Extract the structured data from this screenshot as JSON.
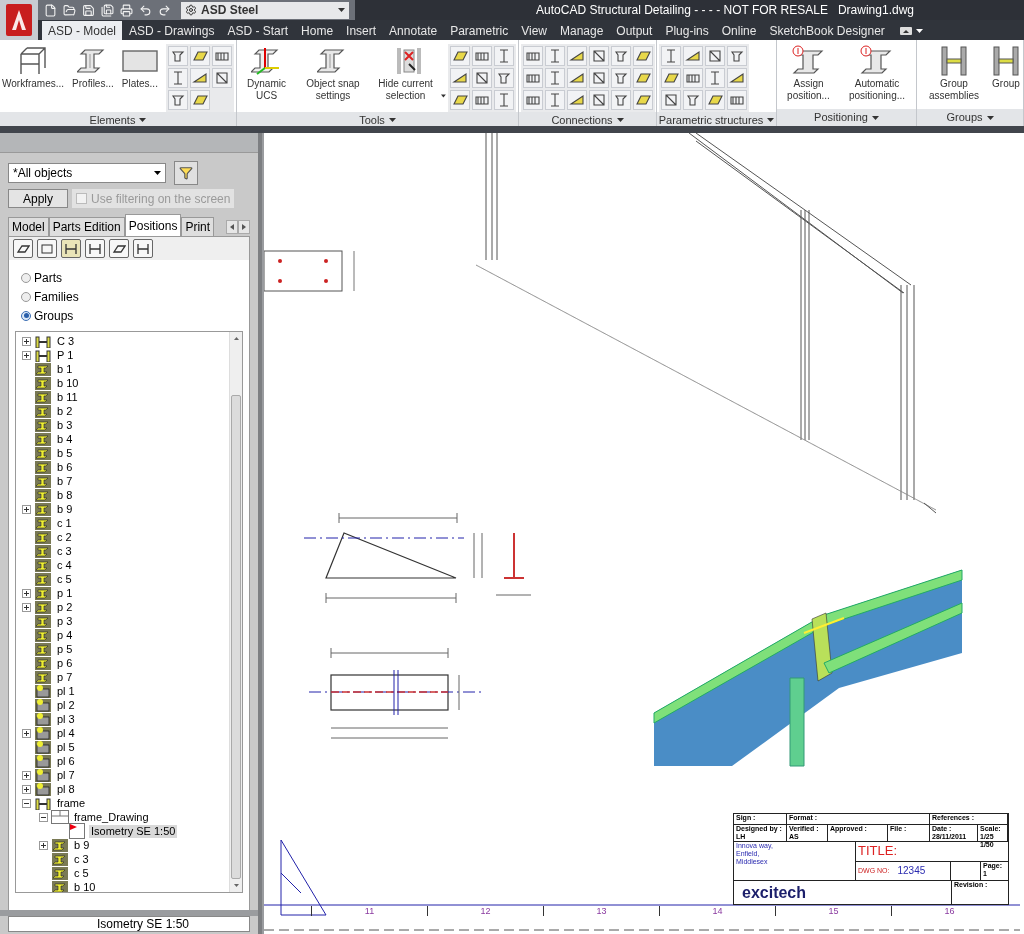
{
  "title_bar": {
    "workspace": "ASD Steel",
    "title": "AutoCAD Structural Detailing - - - - NOT FOR RESALE",
    "document": "Drawing1.dwg"
  },
  "ribbon_tabs": [
    {
      "label": "ASD - Model",
      "selected": true
    },
    {
      "label": "ASD - Drawings",
      "selected": false
    },
    {
      "label": "ASD - Start",
      "selected": false
    },
    {
      "label": "Home",
      "selected": false
    },
    {
      "label": "Insert",
      "selected": false
    },
    {
      "label": "Annotate",
      "selected": false
    },
    {
      "label": "Parametric",
      "selected": false
    },
    {
      "label": "View",
      "selected": false
    },
    {
      "label": "Manage",
      "selected": false
    },
    {
      "label": "Output",
      "selected": false
    },
    {
      "label": "Plug-ins",
      "selected": false
    },
    {
      "label": "Online",
      "selected": false
    },
    {
      "label": "SketchBook Designer",
      "selected": false
    }
  ],
  "ribbon_panels": [
    {
      "title": "Elements",
      "buttons": [
        {
          "label": "Workframes...",
          "kind": "frame",
          "menu": false
        },
        {
          "label": "Profiles...",
          "kind": "beam",
          "menu": false
        },
        {
          "label": "Plates...",
          "kind": "plate",
          "menu": false
        }
      ]
    },
    {
      "title": "Tools",
      "buttons": [
        {
          "label": "Dynamic UCS",
          "kind": "ucs",
          "menu": false
        },
        {
          "label": "Object snap settings",
          "kind": "beam",
          "menu": false
        },
        {
          "label": "Hide current selection",
          "kind": "hide",
          "menu": true
        }
      ]
    },
    {
      "title": "Connections"
    },
    {
      "title": "Parametric structures"
    },
    {
      "title": "Positioning",
      "buttons": [
        {
          "label": "Assign position...",
          "kind": "position",
          "menu": false
        },
        {
          "label": "Automatic positioning...",
          "kind": "position",
          "menu": false
        }
      ]
    },
    {
      "title": "Groups",
      "buttons": [
        {
          "label": "Group assemblies",
          "kind": "group",
          "menu": false
        },
        {
          "label": "Group",
          "kind": "group",
          "menu": false
        }
      ]
    }
  ],
  "filter": {
    "value": "*All objects"
  },
  "apply_button": "Apply",
  "screen_filter": {
    "label": "Use filtering on the screen",
    "checked": false,
    "disabled": true
  },
  "panel_tabs": [
    {
      "label": "Model",
      "selected": false
    },
    {
      "label": "Parts Edition",
      "selected": false
    },
    {
      "label": "Positions",
      "selected": true
    },
    {
      "label": "Print",
      "selected": false
    }
  ],
  "mode_options": [
    {
      "label": "Parts",
      "selected": false
    },
    {
      "label": "Families",
      "selected": false
    },
    {
      "label": "Groups",
      "selected": true
    }
  ],
  "tree": [
    {
      "label": "C 3",
      "kind": "assembly",
      "expanded": false,
      "selected": false
    },
    {
      "label": "P 1",
      "kind": "assembly",
      "expanded": false,
      "selected": false
    },
    {
      "label": "b 1",
      "kind": "beam",
      "selected": false
    },
    {
      "label": "b 10",
      "kind": "beam",
      "selected": false
    },
    {
      "label": "b 11",
      "kind": "beam",
      "selected": false
    },
    {
      "label": "b 2",
      "kind": "beam",
      "selected": false
    },
    {
      "label": "b 3",
      "kind": "beam",
      "selected": false
    },
    {
      "label": "b 4",
      "kind": "beam",
      "selected": false
    },
    {
      "label": "b 5",
      "kind": "beam",
      "selected": false
    },
    {
      "label": "b 6",
      "kind": "beam",
      "selected": false
    },
    {
      "label": "b 7",
      "kind": "beam",
      "selected": false
    },
    {
      "label": "b 8",
      "kind": "beam",
      "selected": false
    },
    {
      "label": "b 9",
      "kind": "beam",
      "expanded": false,
      "selected": false
    },
    {
      "label": "c 1",
      "kind": "beam",
      "selected": false
    },
    {
      "label": "c 2",
      "kind": "beam",
      "selected": false
    },
    {
      "label": "c 3",
      "kind": "beam",
      "selected": false
    },
    {
      "label": "c 4",
      "kind": "beam",
      "selected": false
    },
    {
      "label": "c 5",
      "kind": "beam",
      "selected": false
    },
    {
      "label": "p 1",
      "kind": "beam",
      "expanded": false,
      "selected": false
    },
    {
      "label": "p 2",
      "kind": "beam",
      "expanded": false,
      "selected": false
    },
    {
      "label": "p 3",
      "kind": "beam",
      "selected": false
    },
    {
      "label": "p 4",
      "kind": "beam",
      "selected": false
    },
    {
      "label": "p 5",
      "kind": "beam",
      "selected": false
    },
    {
      "label": "p 6",
      "kind": "beam",
      "selected": false
    },
    {
      "label": "p 7",
      "kind": "beam",
      "selected": false
    },
    {
      "label": "pl 1",
      "kind": "plate",
      "selected": false
    },
    {
      "label": "pl 2",
      "kind": "plate",
      "selected": false
    },
    {
      "label": "pl 3",
      "kind": "plate",
      "selected": false
    },
    {
      "label": "pl 4",
      "kind": "plate",
      "expanded": false,
      "selected": false
    },
    {
      "label": "pl 5",
      "kind": "plate",
      "selected": false
    },
    {
      "label": "pl 6",
      "kind": "plate",
      "selected": false
    },
    {
      "label": "pl 7",
      "kind": "plate",
      "expanded": false,
      "selected": false
    },
    {
      "label": "pl 8",
      "kind": "plate",
      "expanded": false,
      "selected": false
    },
    {
      "label": "frame",
      "kind": "assembly",
      "expanded": true,
      "selected": false,
      "children": [
        {
          "label": "frame_Drawing",
          "kind": "drawing",
          "expanded": true,
          "selected": false,
          "children": [
            {
              "label": "Isometry SE 1:50",
              "kind": "view",
              "selected": true
            }
          ]
        },
        {
          "label": "b 9",
          "kind": "beam",
          "expanded": false,
          "selected": false
        },
        {
          "label": "c 3",
          "kind": "beam",
          "selected": false
        },
        {
          "label": "c 5",
          "kind": "beam",
          "selected": false
        },
        {
          "label": "b 10",
          "kind": "beam",
          "selected": false
        }
      ]
    }
  ],
  "status": "Isometry SE 1:50",
  "title_block": {
    "top_row": [
      "Sign :",
      "Format :",
      "References :"
    ],
    "fields": [
      {
        "label": "Designed by :",
        "value": "LH"
      },
      {
        "label": "Verified :",
        "value": "AS"
      },
      {
        "label": "Approved :"
      },
      {
        "label": "File :"
      },
      {
        "label": "Date :",
        "value": "28/11/2011"
      },
      {
        "label": "Scale:",
        "value": "1/25 1/50"
      }
    ],
    "address": [
      "Innova way,",
      "Enfield,",
      "Middlesex"
    ],
    "title_label": "TITLE:",
    "dwg_label": "DWG NO:",
    "dwg_number": "12345",
    "page_label": "Page:",
    "page": "1",
    "revision_label": "Revision :",
    "company": "excitech"
  },
  "grid_numbers": [
    "11",
    "12",
    "13",
    "14",
    "15",
    "16"
  ]
}
